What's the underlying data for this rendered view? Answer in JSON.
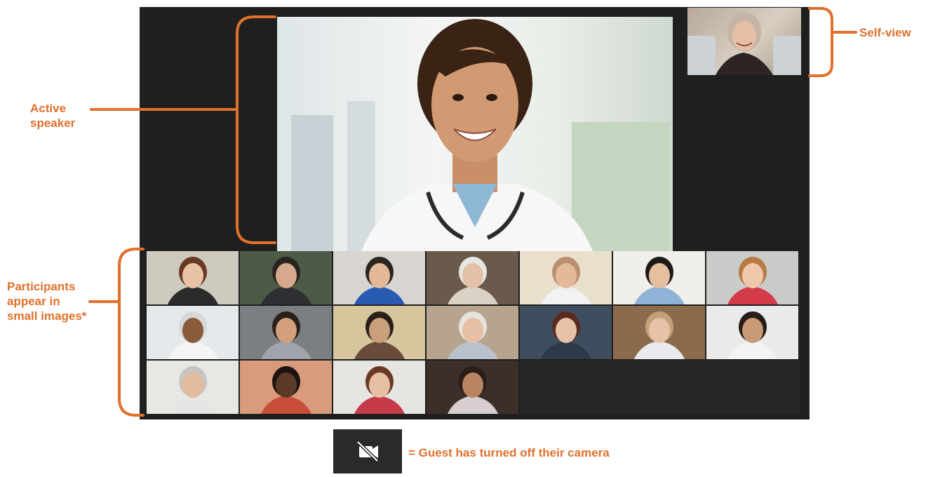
{
  "annotations": {
    "active_speaker": [
      "Active",
      "speaker"
    ],
    "self_view": "Self-view",
    "participants": [
      "Participants",
      "appear in",
      "small images*"
    ]
  },
  "legend": {
    "icon": "video-camera-off-icon",
    "text": "= Guest has turned off their camera"
  },
  "colors": {
    "annotation": "#e0702c",
    "call_background": "#1f1f1f",
    "camera_off_tile": "#2a2a2a"
  },
  "participant_tiles": [
    {
      "bg": "#cfcac0",
      "skin": "#e9c3a5",
      "hair": "#6a3a22",
      "shirt": "#2b2b2b"
    },
    {
      "bg": "#4d5a45",
      "skin": "#d6a98c",
      "hair": "#2a2421",
      "shirt": "#2d2f33"
    },
    {
      "bg": "#d8d4cf",
      "skin": "#e3b896",
      "hair": "#2b241f",
      "shirt": "#2a5bb2"
    },
    {
      "bg": "#6a5a4c",
      "skin": "#e4c0a8",
      "hair": "#e8e6e2",
      "shirt": "#d9d2c5"
    },
    {
      "bg": "#e8e0cd",
      "skin": "#e3b99a",
      "hair": "#b98f70",
      "shirt": "#f2f2f2"
    },
    {
      "bg": "#f1efe9",
      "skin": "#e6bf9e",
      "hair": "#1e1a19",
      "shirt": "#8fb3d6"
    },
    {
      "bg": "#c9ccc9",
      "skin": "#efc7aa",
      "hair": "#b87a45",
      "shirt": "#d33a4a"
    },
    {
      "bg": "#e6e9ec",
      "skin": "#8a5a3c",
      "hair": "#d8d8d8",
      "shirt": "#f4f4f4"
    },
    {
      "bg": "#7b7e82",
      "skin": "#d2a07c",
      "hair": "#2a1f1a",
      "shirt": "#9ea4aa"
    },
    {
      "bg": "#d7c59e",
      "skin": "#caa07c",
      "hair": "#2a201b",
      "shirt": "#6a4a3a"
    },
    {
      "bg": "#b7a48f",
      "skin": "#e7bfa4",
      "hair": "#e6e3de",
      "shirt": "#b9c2cc"
    },
    {
      "bg": "#3e4e5e",
      "skin": "#e8c2a8",
      "hair": "#5a2c20",
      "shirt": "#2c3a4a"
    },
    {
      "bg": "#8a6c4c",
      "skin": "#e8c2a6",
      "hair": "#c2a07a",
      "shirt": "#e9e9ef"
    },
    {
      "bg": "#e9ebea",
      "skin": "#c99a74",
      "hair": "#241d19",
      "shirt": "#f3f3f3"
    },
    {
      "bg": "#e7e8e4",
      "skin": "#e2bb9c",
      "hair": "#c8c4c0",
      "shirt": "#e6e6e6"
    },
    {
      "bg": "#d99b7b",
      "skin": "#5c3a28",
      "hair": "#1c1410",
      "shirt": "#c94e3a"
    },
    {
      "bg": "#e7e5e1",
      "skin": "#e7c0a3",
      "hair": "#6a3a26",
      "shirt": "#c63a4a"
    },
    {
      "bg": "#3c2e28",
      "skin": "#b98561",
      "hair": "#2a1f1a",
      "shirt": "#d7cfcf"
    }
  ]
}
